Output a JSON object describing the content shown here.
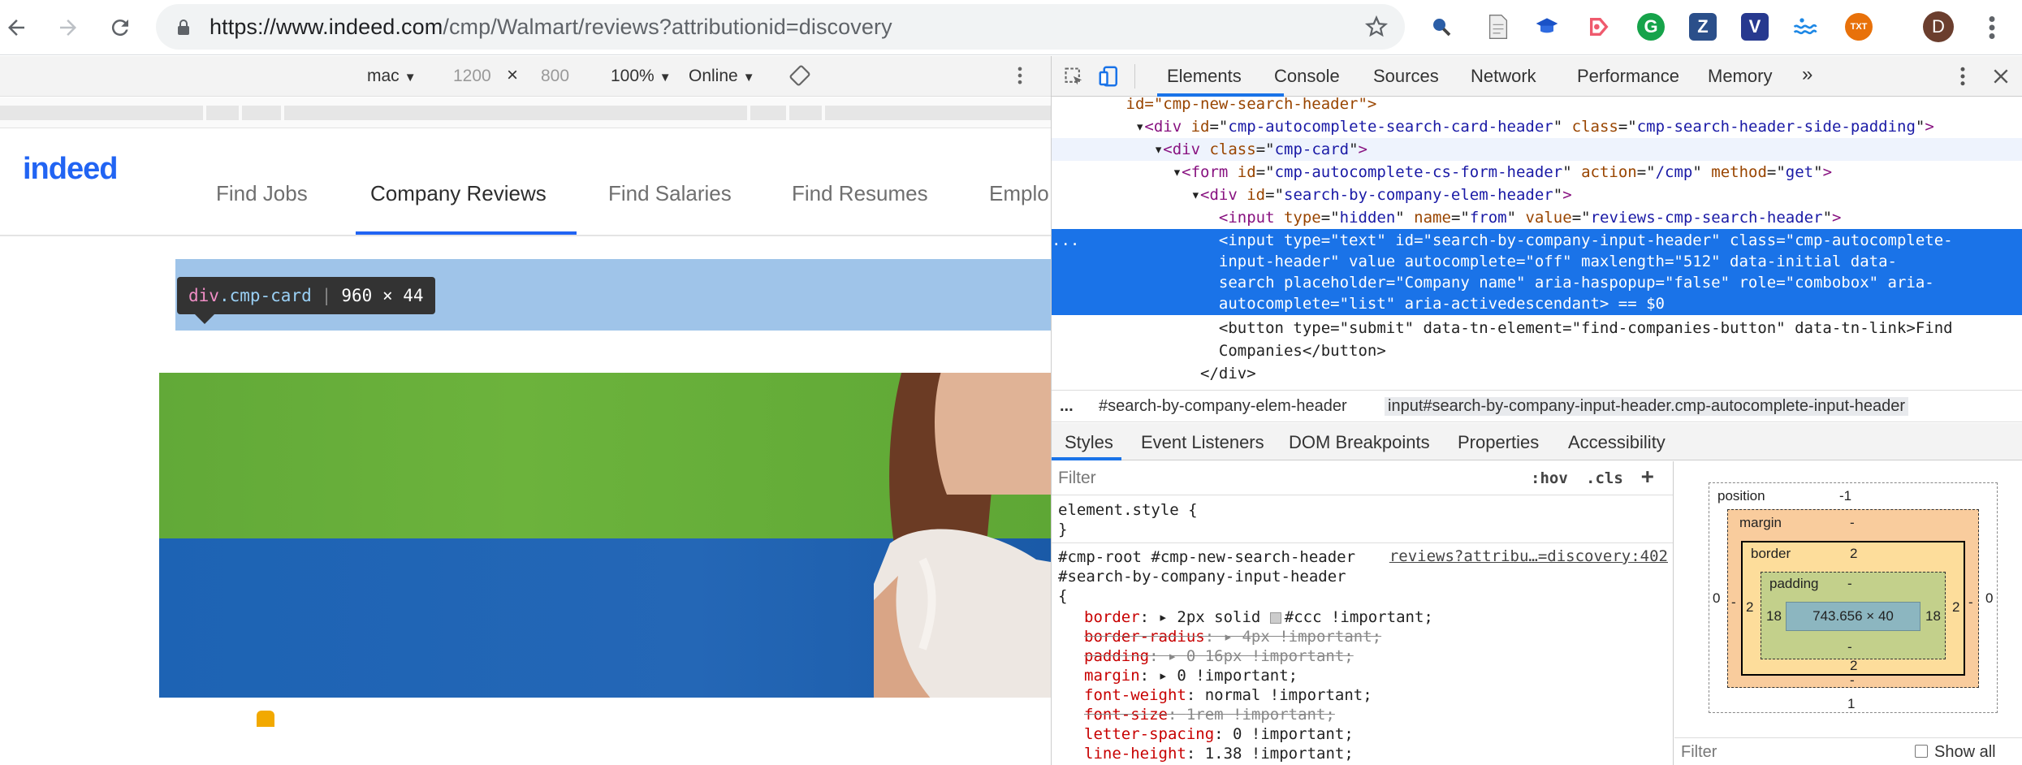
{
  "browser": {
    "url_scheme_host": "https://www.indeed.com",
    "url_path": "/cmp/Walmart/reviews?attributionid=discovery",
    "extensions": [
      "Z",
      "V"
    ],
    "avatar_letter": "D"
  },
  "device_toolbar": {
    "device": "mac",
    "width": "1200",
    "times": "×",
    "height": "800",
    "zoom": "100%",
    "network": "Online"
  },
  "site": {
    "logo": "indeed",
    "nav": [
      "Find Jobs",
      "Company Reviews",
      "Find Salaries",
      "Find Resumes",
      "Emplo"
    ],
    "search_placeholder": "Company name"
  },
  "inspect_tooltip": {
    "tag": "div",
    "class": ".cmp-card",
    "size": "960 × 44"
  },
  "devtools": {
    "tabs": [
      "Elements",
      "Console",
      "Sources",
      "Network",
      "Performance",
      "Memory",
      "»"
    ],
    "dom": [
      {
        "indent": "        ",
        "text": "id=\"cmp-new-search-header\">",
        "kind": "plain"
      },
      {
        "indent": "         ▾",
        "tag": "div",
        "attrs": [
          [
            "id",
            "cmp-autocomplete-search-card-header"
          ],
          [
            "class",
            "cmp-search-header-side-padding"
          ]
        ]
      },
      {
        "indent": "           ▾",
        "tag": "div",
        "attrs": [
          [
            "class",
            "cmp-card"
          ]
        ]
      },
      {
        "indent": "             ▾",
        "tag": "form",
        "attrs": [
          [
            "id",
            "cmp-autocomplete-cs-form-header"
          ],
          [
            "action",
            "/cmp"
          ],
          [
            "method",
            "get"
          ]
        ]
      },
      {
        "indent": "               ▾",
        "tag": "div",
        "attrs": [
          [
            "id",
            "search-by-company-elem-header"
          ]
        ]
      },
      {
        "indent": "                  ",
        "tag": "input",
        "attrs": [
          [
            "type",
            "hidden"
          ],
          [
            "name",
            "from"
          ],
          [
            "value",
            "reviews-cmp-search-header"
          ]
        ]
      }
    ],
    "selected_lines": [
      "...               <input type=\"text\" id=\"search-by-company-input-header\" class=\"cmp-autocomplete-",
      "                  input-header\" value autocomplete=\"off\" maxlength=\"512\" data-initial data-",
      "                  search placeholder=\"Company name\" aria-haspopup=\"false\" role=\"combobox\" aria-",
      "                  autocomplete=\"list\" aria-activedescendant> == $0"
    ],
    "after_lines": [
      "                  <button type=\"submit\" data-tn-element=\"find-companies-button\" data-tn-link>Find",
      "                  Companies</button>",
      "                </div>"
    ],
    "breadcrumbs": [
      "...",
      "#search-by-company-elem-header",
      "input#search-by-company-input-header.cmp-autocomplete-input-header"
    ],
    "sub_tabs": [
      "Styles",
      "Event Listeners",
      "DOM Breakpoints",
      "Properties",
      "Accessibility"
    ],
    "styles": {
      "filter_placeholder": "Filter",
      "hov": ":hov",
      "cls": ".cls",
      "add": "+",
      "element_style": "element.style {",
      "close_brace": "}",
      "selector_1": "#cmp-root #cmp-new-search-header",
      "selector_2": "#search-by-company-input-header",
      "open_brace": "{",
      "source": "reviews?attribu…=discovery:402",
      "declarations": [
        {
          "prop": "border",
          "value": "2px solid ",
          "swatch": true,
          "value2": "#ccc !important;",
          "struck": false,
          "arrow": true
        },
        {
          "prop": "border-radius",
          "value": "4px !important;",
          "struck": true,
          "arrow": true
        },
        {
          "prop": "padding",
          "value": "0 16px !important;",
          "struck": true,
          "arrow": true
        },
        {
          "prop": "margin",
          "value": "0 !important;",
          "struck": false,
          "arrow": true
        },
        {
          "prop": "font-weight",
          "value": "normal !important;",
          "struck": false,
          "arrow": false
        },
        {
          "prop": "font-size",
          "value": "1rem !important;",
          "struck": true,
          "arrow": false
        },
        {
          "prop": "letter-spacing",
          "value": "0 !important;",
          "struck": false,
          "arrow": false
        },
        {
          "prop": "line-height",
          "value": "1.38 !important;",
          "struck": false,
          "arrow": false
        }
      ]
    },
    "box_model": {
      "position_label": "position",
      "position_value": "-1",
      "margin_label": "margin",
      "margin_top": "-",
      "margin_bottom": "-",
      "margin_left": "-",
      "margin_right": "-",
      "border_label": "border",
      "border_top": "2",
      "border_bottom": "2",
      "border_left": "2",
      "border_right": "2",
      "padding_label": "padding",
      "padding_top": "-",
      "padding_bottom": "-",
      "padding_left": "18",
      "padding_right": "18",
      "content": "743.656 × 40",
      "position_left": "0",
      "position_right": "0",
      "position_bottom": "1",
      "filter": "Filter",
      "show_all": "Show all"
    }
  }
}
